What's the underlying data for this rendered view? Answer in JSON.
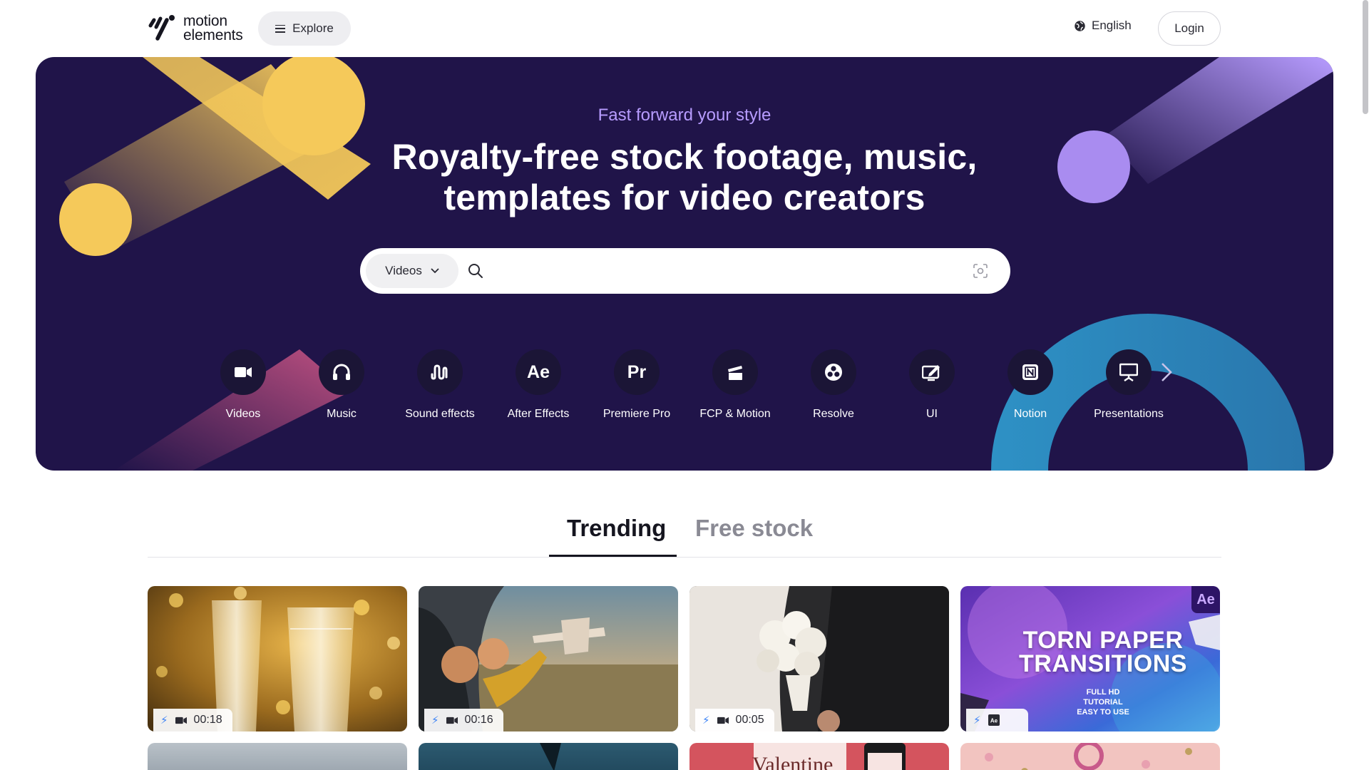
{
  "header": {
    "logo_text_line1": "motion",
    "logo_text_line2": "elements",
    "explore_label": "Explore",
    "language_label": "English",
    "login_label": "Login"
  },
  "hero": {
    "tagline": "Fast forward your style",
    "headline_line1": "Royalty-free stock footage, music,",
    "headline_line2": "templates for video creators",
    "search": {
      "type_selected": "Videos",
      "placeholder": "",
      "value": ""
    },
    "categories": [
      {
        "label": "Videos",
        "icon": "video-camera-icon"
      },
      {
        "label": "Music",
        "icon": "headphones-icon"
      },
      {
        "label": "Sound effects",
        "icon": "soundwave-icon"
      },
      {
        "label": "After Effects",
        "icon": "after-effects-icon",
        "glyph": "Ae"
      },
      {
        "label": "Premiere Pro",
        "icon": "premiere-pro-icon",
        "glyph": "Pr"
      },
      {
        "label": "FCP & Motion",
        "icon": "clapperboard-icon"
      },
      {
        "label": "Resolve",
        "icon": "resolve-icon"
      },
      {
        "label": "UI",
        "icon": "ui-edit-icon"
      },
      {
        "label": "Notion",
        "icon": "notion-icon"
      },
      {
        "label": "Presentations",
        "icon": "presentation-icon"
      }
    ],
    "colors": {
      "background": "#201449",
      "yellow": "#f5c95a",
      "lavender": "#a98cf0",
      "teal": "#2a8fc4"
    }
  },
  "tabs": [
    {
      "label": "Trending",
      "active": true
    },
    {
      "label": "Free stock",
      "active": false
    }
  ],
  "cards": [
    {
      "type": "video",
      "duration": "00:18",
      "subject": "champagne glasses"
    },
    {
      "type": "video",
      "duration": "00:16",
      "subject": "kids with toy plane"
    },
    {
      "type": "video",
      "duration": "00:05",
      "subject": "wedding bouquet"
    },
    {
      "type": "after-effects",
      "title_line1": "TORN PAPER",
      "title_line2": "TRANSITIONS",
      "sub_line1": "FULL HD",
      "sub_line2": "TUTORIAL",
      "sub_line3": "EASY TO USE",
      "badge": "Ae"
    }
  ],
  "row2": {
    "valentine_text": "Valentine"
  }
}
